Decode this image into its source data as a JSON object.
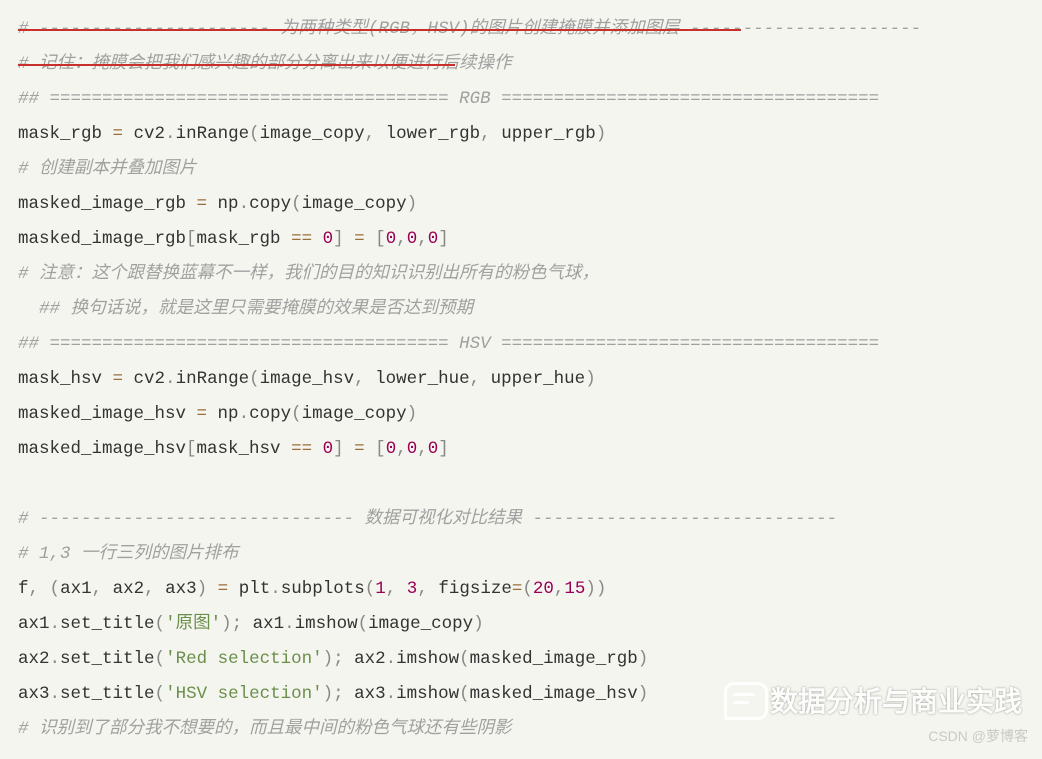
{
  "c01": "# ---------------------- 为两种类型(RGB，HSV)的图片创建掩膜并添加图层 ----------------------",
  "c02": "# 记住：掩膜会把我们感兴趣的部分分离出来以便进行后续操作",
  "c03_a": "## ====================================== ",
  "c03_b": "RGB",
  "c03_c": " ====================================",
  "l04_a": "mask_rgb ",
  "l04_b": " cv2",
  "l04_c": "inRange",
  "l04_d": "image_copy",
  "l04_e": " lower_rgb",
  "l04_f": " upper_rgb",
  "c05": "# 创建副本并叠加图片",
  "l06_a": "masked_image_rgb ",
  "l06_b": " np",
  "l06_c": "copy",
  "l06_d": "image_copy",
  "l07_a": "masked_image_rgb",
  "l07_b": "mask_rgb ",
  "l07_eq": "==",
  "l07_z": "0",
  "l07_v": "0",
  "c08": "# 注意：这个跟替换蓝幕不一样，我们的目的知识识别出所有的粉色气球，",
  "c09": "  ## 换句话说，就是这里只需要掩膜的效果是否达到预期",
  "c10_a": "## ====================================== ",
  "c10_b": "HSV",
  "c10_c": " ====================================",
  "l11_a": "mask_hsv ",
  "l11_b": " cv2",
  "l11_c": "inRange",
  "l11_d": "image_hsv",
  "l11_e": " lower_hue",
  "l11_f": " upper_hue",
  "l12_a": "masked_image_hsv ",
  "l12_b": " np",
  "l12_c": "copy",
  "l12_d": "image_copy",
  "l13_a": "masked_image_hsv",
  "l13_b": "mask_hsv ",
  "c15": "# ------------------------------ 数据可视化对比结果 -----------------------------",
  "c16": "# 1,3 一行三列的图片排布",
  "l17_a": "f",
  "l17_b": "ax1",
  "l17_c": " ax2",
  "l17_d": " ax3",
  "l17_e": " plt",
  "l17_f": "subplots",
  "l17_g": "1",
  "l17_h": "3",
  "l17_i": " figsize",
  "l17_j": "20",
  "l17_k": "15",
  "l18_a": "ax1",
  "l18_b": "set_title",
  "l18_c": "'原图'",
  "l18_d": " ax1",
  "l18_e": "imshow",
  "l18_f": "image_copy",
  "l19_a": "ax2",
  "l19_b": "set_title",
  "l19_c": "'Red selection'",
  "l19_d": " ax2",
  "l19_e": "imshow",
  "l19_f": "masked_image_rgb",
  "l20_a": "ax3",
  "l20_b": "set_title",
  "l20_c": "'HSV selection'",
  "l20_d": " ax3",
  "l20_e": "imshow",
  "l20_f": "masked_image_hsv",
  "c21": "# 识别到了部分我不想要的，而且最中间的粉色气球还有些阴影",
  "wm1": "数据分析与商业实践",
  "wm2": "CSDN @萝博客"
}
